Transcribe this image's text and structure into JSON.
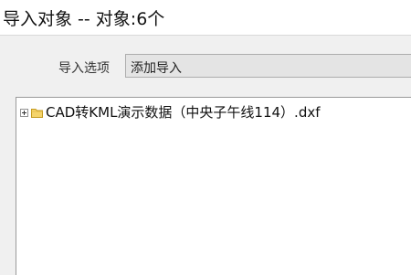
{
  "window": {
    "title": "导入对象 -- 对象:6个"
  },
  "import_options": {
    "label": "导入选项",
    "selected_value": "添加导入"
  },
  "tree": {
    "items": [
      {
        "icon": "folder-icon",
        "expander": "plus",
        "label": "CAD转KML演示数据（中央子午线114）.dxf"
      }
    ]
  },
  "colors": {
    "panel_background": "#f0f0f0",
    "folder_fill": "#f5d46b",
    "folder_stroke": "#c49a1e"
  }
}
